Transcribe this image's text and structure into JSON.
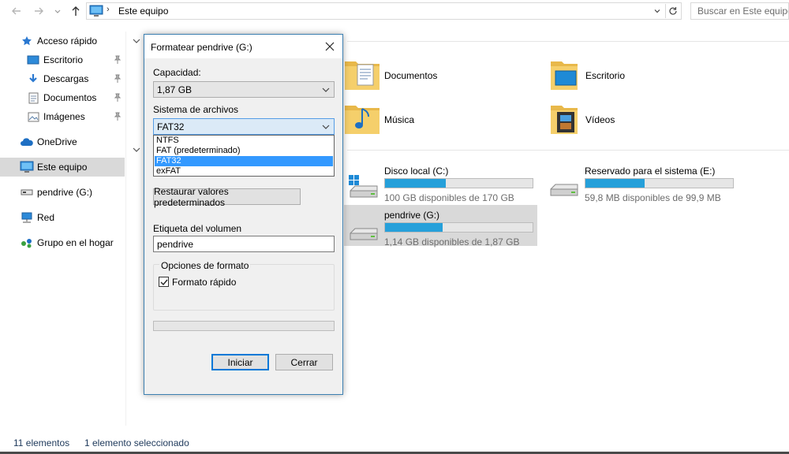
{
  "addressbar": {
    "breadcrumb_sep": "›",
    "location": "Este equipo",
    "search_placeholder": "Buscar en Este equipo"
  },
  "navpane": {
    "items": [
      {
        "label": "Acceso rápido",
        "icon": "star-icon"
      },
      {
        "label": "Escritorio",
        "icon": "desktop-icon",
        "pinned": true
      },
      {
        "label": "Descargas",
        "icon": "download-icon",
        "pinned": true
      },
      {
        "label": "Documentos",
        "icon": "document-icon",
        "pinned": true
      },
      {
        "label": "Imágenes",
        "icon": "pictures-icon",
        "pinned": true
      },
      {
        "label": "OneDrive",
        "icon": "cloud-icon"
      },
      {
        "label": "Este equipo",
        "icon": "computer-icon",
        "selected": true
      },
      {
        "label": "pendrive (G:)",
        "icon": "usb-drive-icon"
      },
      {
        "label": "Red",
        "icon": "network-icon"
      },
      {
        "label": "Grupo en el hogar",
        "icon": "homegroup-icon"
      }
    ]
  },
  "folders": [
    {
      "label": "Documentos",
      "icon": "documents-folder-icon"
    },
    {
      "label": "Escritorio",
      "icon": "desktop-folder-icon"
    },
    {
      "label": "Música",
      "icon": "music-folder-icon"
    },
    {
      "label": "Vídeos",
      "icon": "videos-folder-icon"
    }
  ],
  "drives": [
    {
      "name": "Disco local (C:)",
      "free_text": "100 GB disponibles de 170 GB",
      "used_fraction": 0.41,
      "icon": "windows-drive-icon"
    },
    {
      "name": "Reservado para el sistema (E:)",
      "free_text": "59,8 MB disponibles de 99,9 MB",
      "used_fraction": 0.4,
      "icon": "hard-drive-icon"
    },
    {
      "name": "pendrive (G:)",
      "free_text": "1,14 GB disponibles de 1,87 GB",
      "used_fraction": 0.39,
      "icon": "usb-drive-icon",
      "selected": true
    }
  ],
  "statusbar": {
    "items_count": "11 elementos",
    "selection": "1 elemento seleccionado"
  },
  "dialog": {
    "title": "Formatear pendrive (G:)",
    "capacity_label": "Capacidad:",
    "capacity_value": "1,87 GB",
    "fs_label": "Sistema de archivos",
    "fs_value": "FAT32",
    "fs_options": [
      "NTFS",
      "FAT (predeterminado)",
      "FAT32",
      "exFAT"
    ],
    "fs_selected_index": 2,
    "restore_button": "Restaurar valores predeterminados",
    "volume_label": "Etiqueta del volumen",
    "volume_value": "pendrive",
    "format_options_label": "Opciones de formato",
    "quick_format_label": "Formato rápido",
    "quick_format_checked": true,
    "progress_fraction": 0,
    "start_button": "Iniciar",
    "close_button": "Cerrar"
  }
}
